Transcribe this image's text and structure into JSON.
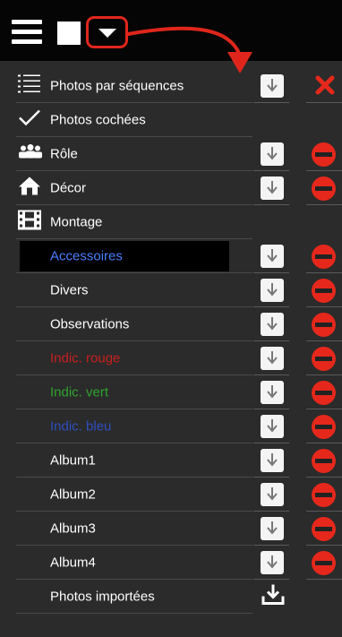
{
  "topbar": {
    "menu_icon": "hamburger-icon",
    "square_icon": "white-square-icon",
    "dropdown_icon": "triangle-down-icon",
    "highlight_color": "#e0261c"
  },
  "menu": {
    "items": [
      {
        "label": "Photos par séquences",
        "icon": "list-icon",
        "color": "#ffffff"
      },
      {
        "label": "Photos cochées",
        "icon": "checkmark-icon",
        "color": "#ffffff"
      },
      {
        "label": "Rôle",
        "icon": "people-icon",
        "color": "#ffffff"
      },
      {
        "label": "Décor",
        "icon": "house-icon",
        "color": "#ffffff"
      },
      {
        "label": "Montage",
        "icon": "film-icon",
        "color": "#ffffff"
      },
      {
        "label": "Accessoires",
        "color": "#4a7fff",
        "selected": true
      },
      {
        "label": "Divers",
        "color": "#ffffff"
      },
      {
        "label": "Observations",
        "color": "#ffffff"
      },
      {
        "label": "Indic. rouge",
        "color": "#c91f1f"
      },
      {
        "label": "Indic. vert",
        "color": "#2ea42e"
      },
      {
        "label": "Indic. bleu",
        "color": "#2f4fc0"
      },
      {
        "label": "Album1",
        "color": "#ffffff"
      },
      {
        "label": "Album2",
        "color": "#ffffff"
      },
      {
        "label": "Album3",
        "color": "#ffffff"
      },
      {
        "label": "Album4",
        "color": "#ffffff"
      },
      {
        "label": "Photos importées",
        "color": "#ffffff"
      }
    ]
  },
  "actions": {
    "download_icon": "download-arrow-icon",
    "remove_icon": "remove-circle-icon",
    "close_icon": "close-x-icon",
    "import_icon": "import-download-icon",
    "remove_color": "#e5281b"
  }
}
